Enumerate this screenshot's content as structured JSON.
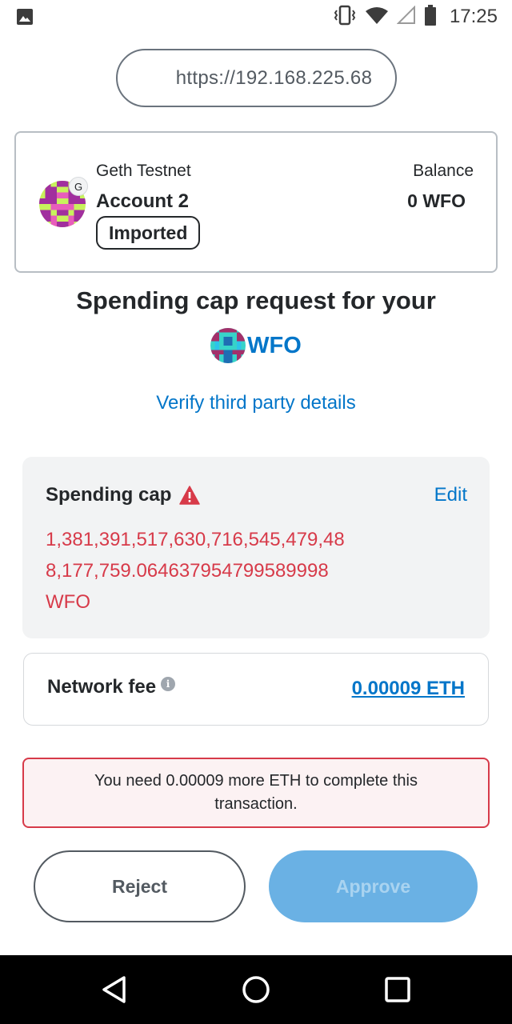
{
  "status_bar": {
    "time": "17:25",
    "icons": [
      "image-notification-icon",
      "vibrate-icon",
      "wifi-icon",
      "cell-signal-icon",
      "battery-icon"
    ]
  },
  "url": "https://192.168.225.68",
  "account": {
    "network": "Geth Testnet",
    "network_badge": "G",
    "name": "Account 2",
    "tag": "Imported",
    "balance_label": "Balance",
    "balance_value": "0 WFO"
  },
  "request": {
    "heading": "Spending cap request for your",
    "token_symbol": "WFO",
    "verify_link": "Verify third party details"
  },
  "spending_cap": {
    "title": "Spending cap",
    "edit_label": "Edit",
    "value": "1,381,391,517,630,716,545,479,488,177,759.064637954799589998 WFO"
  },
  "network_fee": {
    "label": "Network fee",
    "value": "0.00009 ETH"
  },
  "error": {
    "message": "You need 0.00009 more ETH to complete this transaction."
  },
  "buttons": {
    "reject": "Reject",
    "approve": "Approve"
  },
  "colors": {
    "accent": "#0376c9",
    "error": "#d73a49",
    "approve_disabled": "#6ab1e4"
  }
}
